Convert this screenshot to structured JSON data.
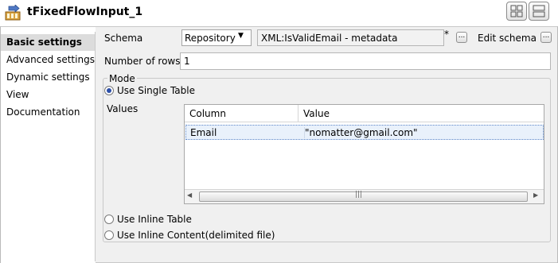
{
  "component": {
    "title": "tFixedFlowInput_1",
    "icon": "component-flow-icon"
  },
  "toolbar": {
    "buttons": [
      "layout-grid-icon",
      "layout-split-icon"
    ]
  },
  "nav": {
    "items": [
      {
        "label": "Basic settings",
        "active": true
      },
      {
        "label": "Advanced settings",
        "active": false
      },
      {
        "label": "Dynamic settings",
        "active": false
      },
      {
        "label": "View",
        "active": false
      },
      {
        "label": "Documentation",
        "active": false
      }
    ]
  },
  "schema": {
    "label": "Schema",
    "type_value": "Repository",
    "repository_value": "XML:IsValidEmail - metadata",
    "modified_marker": "*",
    "edit_label": "Edit schema",
    "browse_label": "...",
    "edit_button_label": "..."
  },
  "rows": {
    "label": "Number of rows",
    "value": "1"
  },
  "mode": {
    "legend": "Mode",
    "options": [
      {
        "label": "Use Single Table",
        "selected": true
      },
      {
        "label": "Use Inline Table",
        "selected": false
      },
      {
        "label": "Use Inline Content(delimited file)",
        "selected": false
      }
    ]
  },
  "values_table": {
    "label": "Values",
    "columns": [
      "Column",
      "Value"
    ],
    "rows": [
      {
        "column": "Email",
        "value": "\"nomatter@gmail.com\""
      }
    ],
    "scroll_grip": "|||"
  },
  "colors": {
    "panel_bg": "#f0f0f0",
    "selection": "#e9f1fb",
    "radio_dot": "#2b4ea8"
  }
}
